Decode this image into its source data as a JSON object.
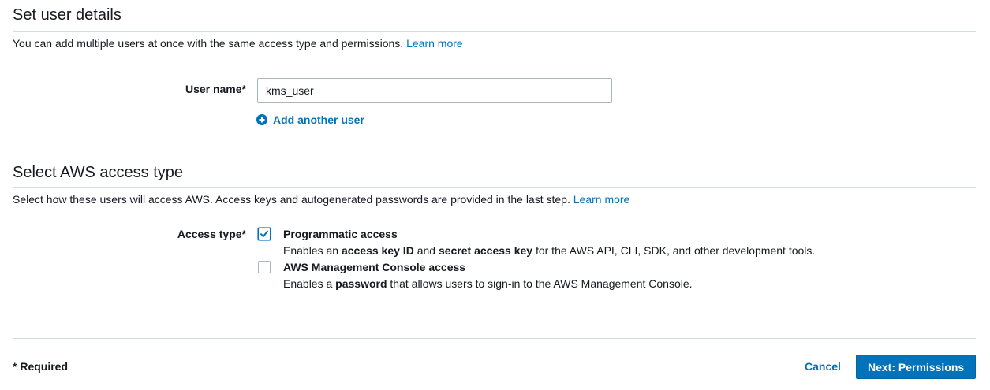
{
  "section1": {
    "title": "Set user details",
    "description": "You can add multiple users at once with the same access type and permissions.",
    "learn_more": "Learn more",
    "user_name_label": "User name*",
    "user_name_value": "kms_user",
    "add_another_user": "Add another user"
  },
  "section2": {
    "title": "Select AWS access type",
    "description": "Select how these users will access AWS. Access keys and autogenerated passwords are provided in the last step.",
    "learn_more": "Learn more",
    "access_type_label": "Access type*",
    "options": [
      {
        "title": "Programmatic access",
        "checked": true,
        "desc_pre": "Enables an ",
        "desc_b1": "access key ID",
        "desc_mid": " and ",
        "desc_b2": "secret access key",
        "desc_post": " for the AWS API, CLI, SDK, and other development tools."
      },
      {
        "title": "AWS Management Console access",
        "checked": false,
        "desc_pre": "Enables a ",
        "desc_b1": "password",
        "desc_post": " that allows users to sign-in to the AWS Management Console."
      }
    ]
  },
  "footer": {
    "required_note": "* Required",
    "cancel_label": "Cancel",
    "next_label": "Next: Permissions"
  },
  "colors": {
    "accent": "#0073bb",
    "text": "#16191f",
    "border": "#aab7b8",
    "rule": "#d5dbdb"
  },
  "icons": {
    "add_user": "plus-circle-icon",
    "checkmark": "checkmark-icon"
  }
}
